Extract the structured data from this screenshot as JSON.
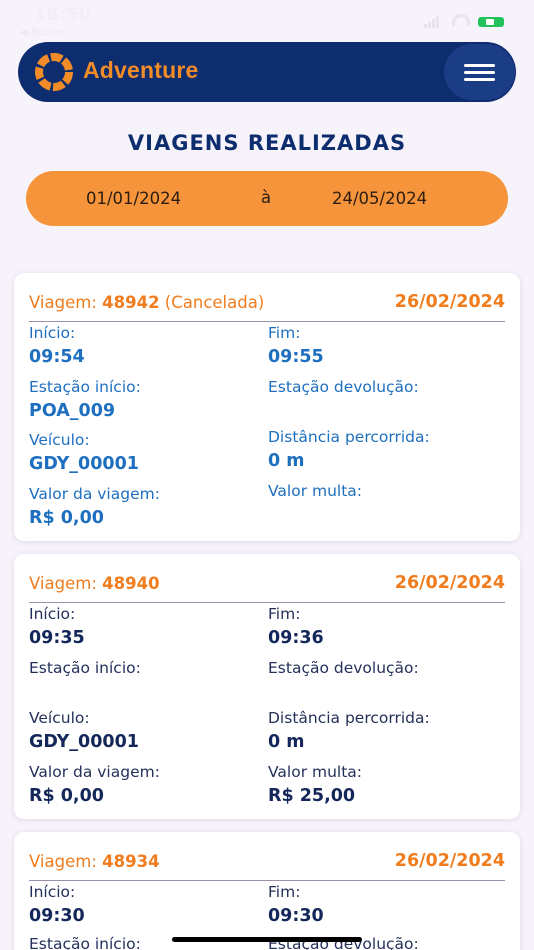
{
  "status": {
    "time": "18:50",
    "back_label": "◀ Buscar"
  },
  "header": {
    "brand": "Adventure",
    "menu_icon": "hamburger-icon",
    "colors": {
      "bar": "#0e2d6e",
      "accent": "#f28c28"
    }
  },
  "page": {
    "title": "VIAGENS REALIZADAS"
  },
  "date_range": {
    "from": "01/01/2024",
    "separator": "à",
    "to": "24/05/2024"
  },
  "labels": {
    "trip_prefix": "Viagem:",
    "start": "Início:",
    "end": "Fim:",
    "start_station": "Estação início:",
    "return_station": "Estação devolução:",
    "vehicle": "Veículo:",
    "distance": "Distância percorrida:",
    "trip_value": "Valor da viagem:",
    "fine_value": "Valor multa:"
  },
  "trips": [
    {
      "number": "48942",
      "status": "(Cancelada)",
      "date": "26/02/2024",
      "start": "09:54",
      "end": "09:55",
      "start_station": "POA_009",
      "return_station": "",
      "vehicle": "GDY_00001",
      "distance": "0 m",
      "trip_value": "R$ 0,00",
      "fine_value": ""
    },
    {
      "number": "48940",
      "status": "",
      "date": "26/02/2024",
      "start": "09:35",
      "end": "09:36",
      "start_station": "",
      "return_station": "",
      "vehicle": "GDY_00001",
      "distance": "0 m",
      "trip_value": "R$ 0,00",
      "fine_value": "R$ 25,00"
    },
    {
      "number": "48934",
      "status": "",
      "date": "26/02/2024",
      "start": "09:30",
      "end": "09:30"
    }
  ]
}
